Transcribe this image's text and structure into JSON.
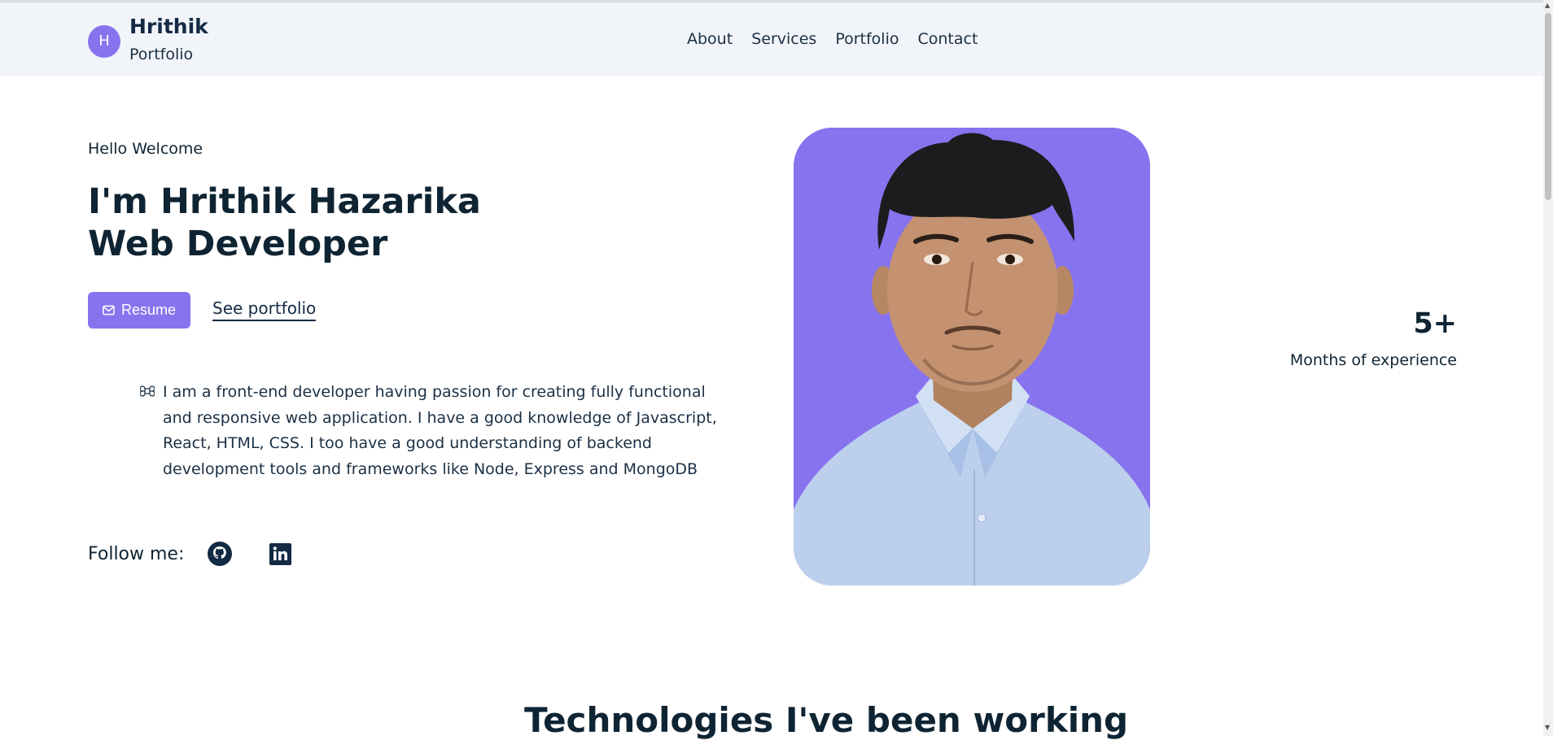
{
  "brand": {
    "initial": "H",
    "name": "Hrithik",
    "subtitle": "Portfolio"
  },
  "nav": {
    "items": [
      "About",
      "Services",
      "Portfolio",
      "Contact"
    ]
  },
  "hero": {
    "greeting": "Hello Welcome",
    "title_line1": "I'm Hrithik Hazarika",
    "title_line2": "Web Developer",
    "resume_label": "Resume",
    "portfolio_link": "See portfolio",
    "description": "I am a front-end developer having passion for creating fully functional and responsive web application. I have a good knowledge of Javascript, React, HTML, CSS. I too have a good understanding of backend development tools and frameworks like Node, Express and MongoDB",
    "follow_label": "Follow me:"
  },
  "stats": {
    "value": "5+",
    "label": "Months of experience"
  },
  "technologies": {
    "title": "Technologies I've been working"
  },
  "colors": {
    "accent": "#8873ee",
    "header_bg": "#f1f4f8",
    "text_dark": "#0f2433"
  },
  "icons": [
    "mail-icon",
    "command-icon",
    "github-icon",
    "linkedin-icon"
  ]
}
